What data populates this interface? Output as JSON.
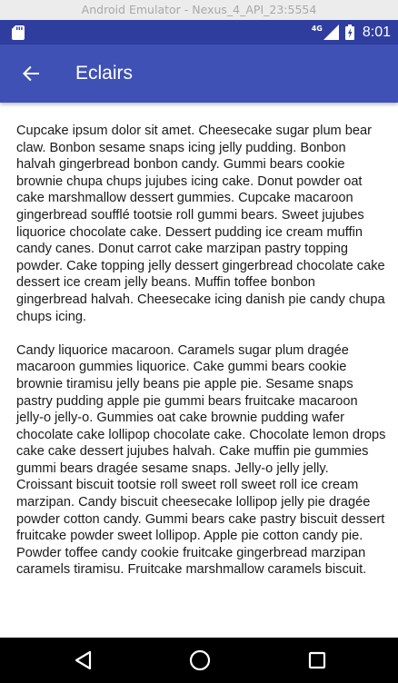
{
  "window": {
    "title": "Android Emulator - Nexus_4_API_23:5554"
  },
  "status_bar": {
    "network_type": "4G",
    "time": "8:01",
    "icons": [
      "sd-card-icon",
      "signal-icon",
      "battery-icon"
    ]
  },
  "app_bar": {
    "title": "Eclairs",
    "back_icon": "arrow-back-icon",
    "color": "#3f51b5",
    "status_color": "#2f3e9e"
  },
  "content": {
    "paragraphs": [
      "Cupcake ipsum dolor sit amet. Cheesecake sugar plum bear claw. Bonbon sesame snaps icing jelly pudding. Bonbon halvah gingerbread bonbon candy. Gummi bears cookie brownie chupa chups jujubes icing cake. Donut powder oat cake marshmallow dessert gummies. Cupcake macaroon gingerbread soufflé tootsie roll gummi bears. Sweet jujubes liquorice chocolate cake. Dessert pudding ice cream muffin candy canes. Donut carrot cake marzipan pastry topping powder. Cake topping jelly dessert gingerbread chocolate cake dessert ice cream jelly beans. Muffin toffee bonbon gingerbread halvah. Cheesecake icing danish pie candy chupa chups icing.",
      "Candy liquorice macaroon. Caramels sugar plum dragée macaroon gummies liquorice. Cake gummi bears cookie brownie tiramisu jelly beans pie apple pie. Sesame snaps pastry pudding apple pie gummi bears fruitcake macaroon jelly-o jelly-o. Gummies oat cake brownie pudding wafer chocolate cake lollipop chocolate cake. Chocolate lemon drops cake cake dessert jujubes halvah. Cake muffin pie gummies gummi bears dragée sesame snaps. Jelly-o jelly jelly. Croissant biscuit tootsie roll sweet roll sweet roll ice cream marzipan. Candy biscuit cheesecake lollipop jelly pie dragée powder cotton candy. Gummi bears cake pastry biscuit dessert fruitcake powder sweet lollipop. Apple pie cotton candy pie. Powder toffee candy cookie fruitcake gingerbread marzipan caramels tiramisu. Fruitcake marshmallow caramels biscuit."
    ]
  },
  "nav_bar": {
    "buttons": [
      "back-triangle-icon",
      "home-circle-icon",
      "recents-square-icon"
    ]
  }
}
